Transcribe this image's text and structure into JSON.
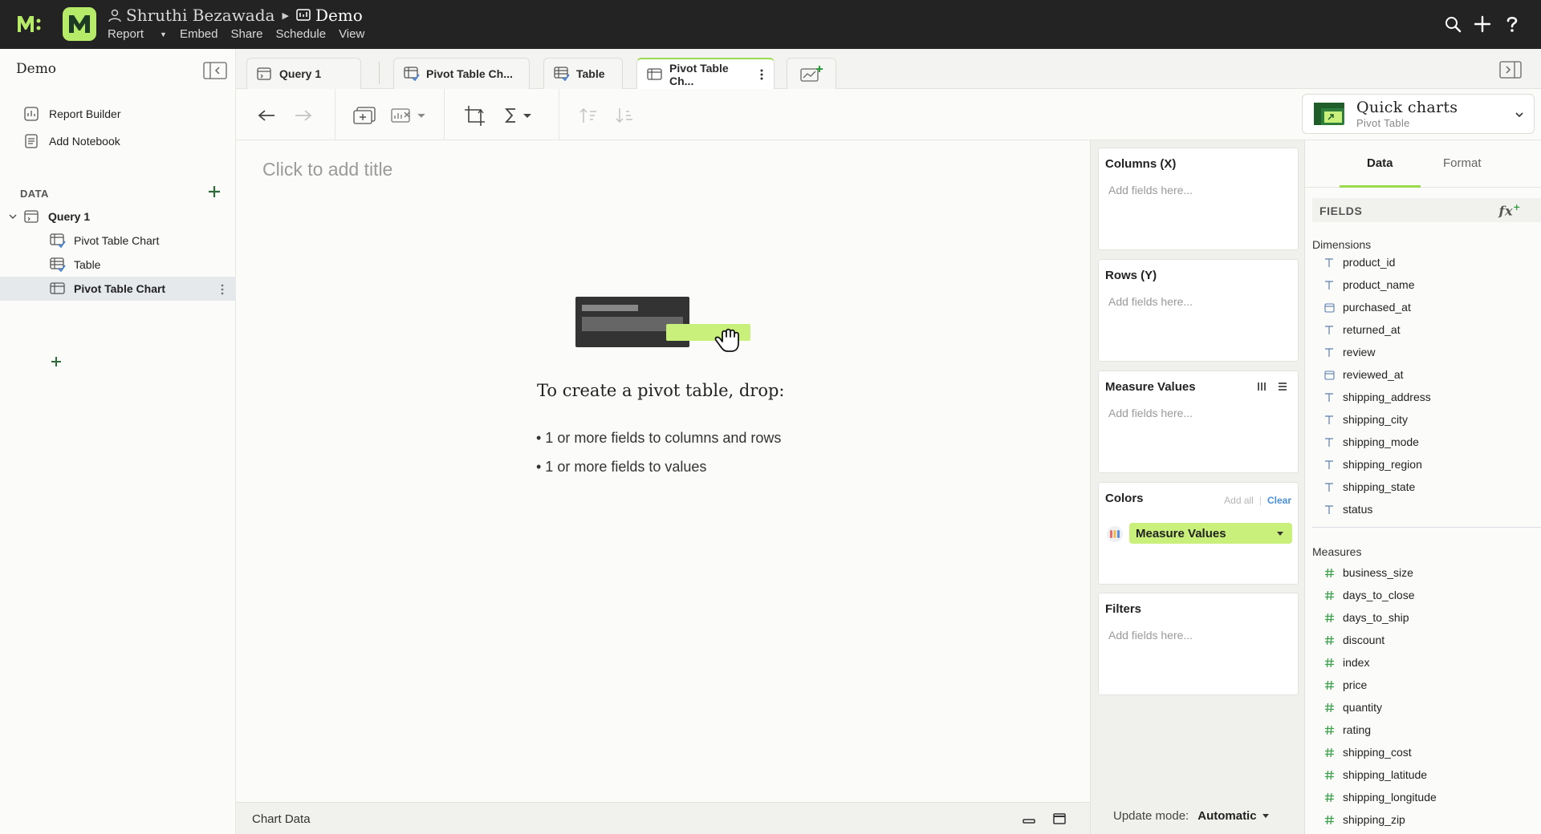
{
  "topbar": {
    "user": "Shruthi Bezawada",
    "workbook": "Demo",
    "menu": [
      "Report",
      "Embed",
      "Share",
      "Schedule",
      "View"
    ]
  },
  "sidebar": {
    "title": "Demo",
    "links": [
      {
        "label": "Report Builder",
        "icon": "report-builder-icon"
      },
      {
        "label": "Add Notebook",
        "icon": "notebook-icon"
      }
    ],
    "data_label": "DATA",
    "query": "Query 1",
    "items": [
      "Pivot Table Chart",
      "Table",
      "Pivot Table Chart"
    ]
  },
  "tabs": [
    "Query 1",
    "Pivot Table Ch...",
    "Table",
    "Pivot Table Ch..."
  ],
  "quick_charts": {
    "title": "Quick charts",
    "subtitle": "Pivot Table"
  },
  "canvas": {
    "title_placeholder": "Click to add title",
    "empty_heading": "To create a pivot table, drop:",
    "empty_items": [
      "• 1 or more fields to columns and rows",
      "• 1 or more fields to values"
    ]
  },
  "chart_data_label": "Chart Data",
  "shelves": {
    "columns": "Columns (X)",
    "rows": "Rows (Y)",
    "measure_values": "Measure Values",
    "colors": "Colors",
    "filters": "Filters",
    "placeholder": "Add fields here...",
    "add_all": "Add all",
    "clear": "Clear",
    "color_pill": "Measure Values"
  },
  "update_mode": {
    "label": "Update mode:",
    "value": "Automatic"
  },
  "panel": {
    "tabs": [
      "Data",
      "Format"
    ],
    "fields_label": "FIELDS",
    "fx": "fx",
    "dimensions_label": "Dimensions",
    "dimensions": [
      {
        "name": "product_id",
        "type": "text"
      },
      {
        "name": "product_name",
        "type": "text"
      },
      {
        "name": "purchased_at",
        "type": "date"
      },
      {
        "name": "returned_at",
        "type": "text"
      },
      {
        "name": "review",
        "type": "text"
      },
      {
        "name": "reviewed_at",
        "type": "date"
      },
      {
        "name": "shipping_address",
        "type": "text"
      },
      {
        "name": "shipping_city",
        "type": "text"
      },
      {
        "name": "shipping_mode",
        "type": "text"
      },
      {
        "name": "shipping_region",
        "type": "text"
      },
      {
        "name": "shipping_state",
        "type": "text"
      },
      {
        "name": "status",
        "type": "text"
      }
    ],
    "measures_label": "Measures",
    "measures": [
      "business_size",
      "days_to_close",
      "days_to_ship",
      "discount",
      "index",
      "price",
      "quantity",
      "rating",
      "shipping_cost",
      "shipping_latitude",
      "shipping_longitude",
      "shipping_zip"
    ]
  },
  "colors": {
    "accent": "#9bd94e",
    "pill": "#c8f07a",
    "link": "#4a90d9",
    "topbar": "#232323"
  }
}
